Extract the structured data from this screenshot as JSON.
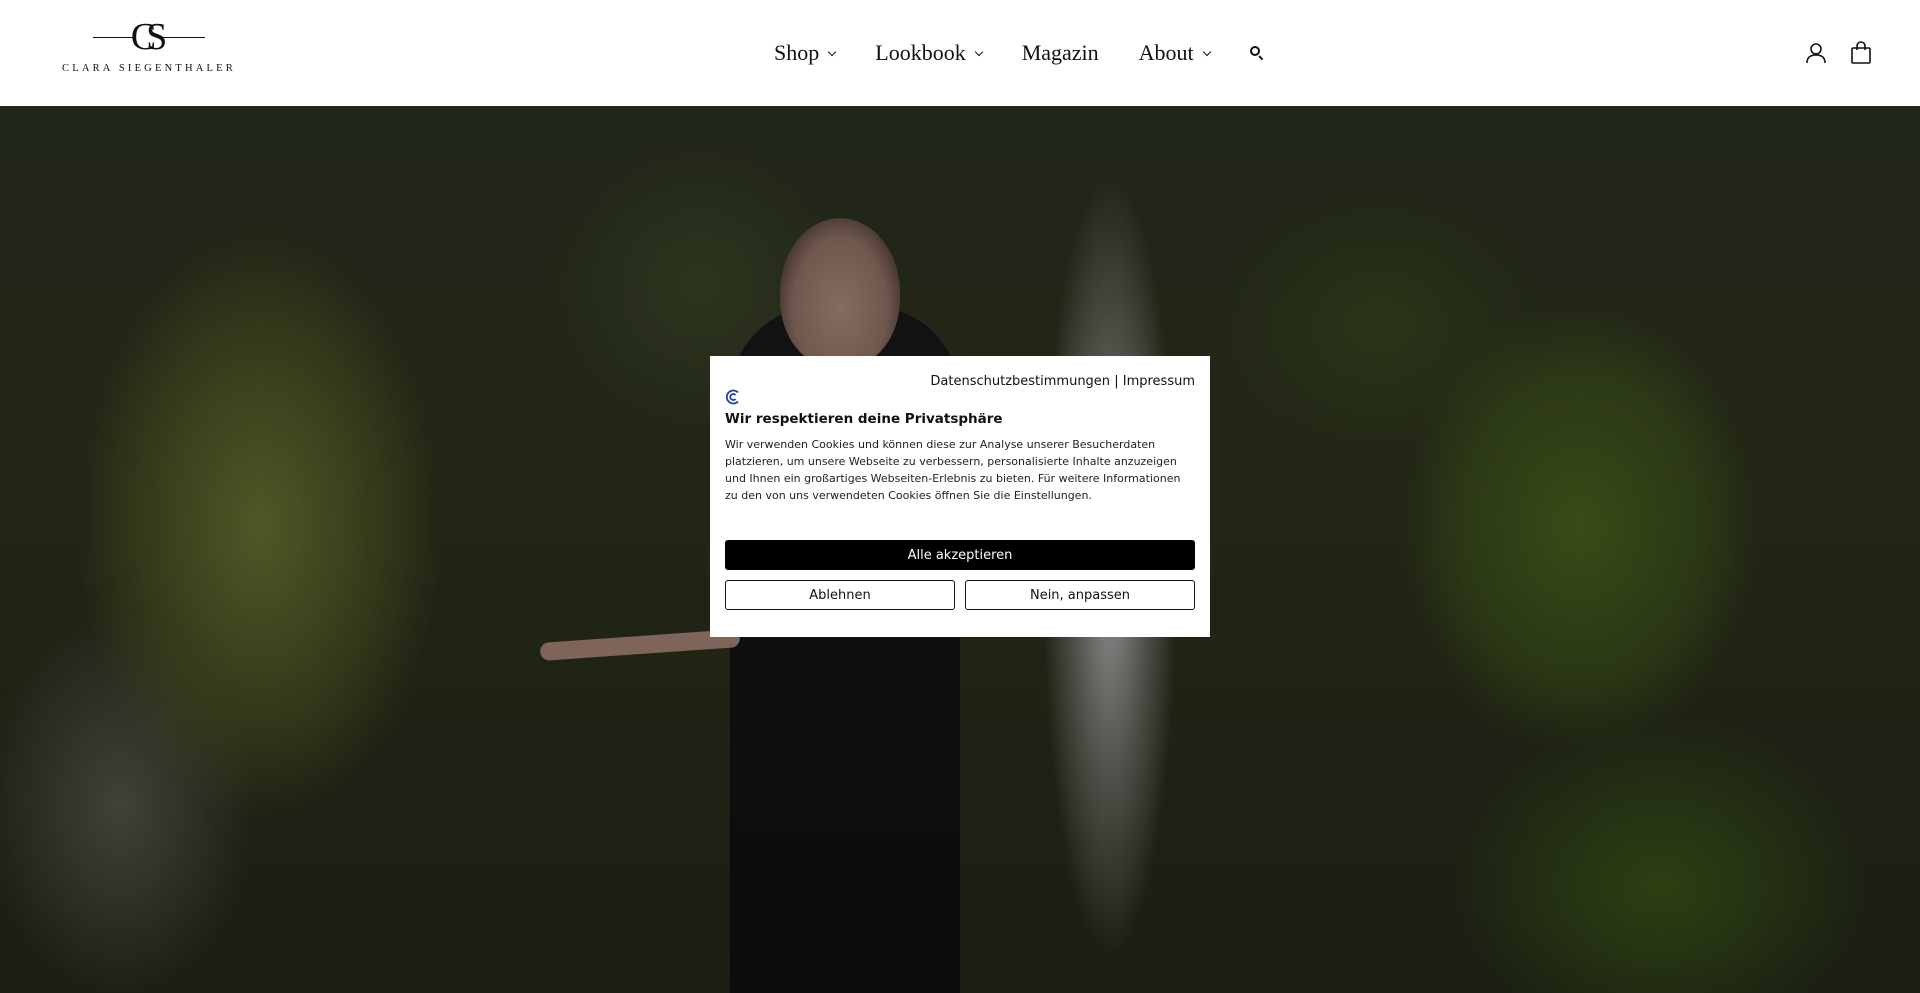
{
  "brand": {
    "monogram": "CS",
    "name": "CLARA SIEGENTHALER"
  },
  "nav": {
    "items": [
      {
        "label": "Shop",
        "dropdown": true
      },
      {
        "label": "Lookbook",
        "dropdown": true
      },
      {
        "label": "Magazin",
        "dropdown": false
      },
      {
        "label": "About",
        "dropdown": true
      }
    ],
    "search_icon": "search-icon"
  },
  "header_icons": {
    "account": "user-icon",
    "cart": "shopping-bag-icon"
  },
  "cookie_banner": {
    "links": {
      "privacy": "Datenschutzbestimmungen",
      "separator": "|",
      "imprint": "Impressum"
    },
    "title": "Wir respektieren deine Privatsphäre",
    "text": "Wir verwenden Cookies und können diese zur Analyse unserer Besucherdaten platzieren, um unsere Webseite zu verbessern, personalisierte Inhalte anzuzeigen und Ihnen ein großartiges Webseiten-Erlebnis zu bieten. Für weitere Informationen zu den von uns verwendeten Cookies öffnen Sie die Einstellungen.",
    "accept_label": "Alle akzeptieren",
    "reject_label": "Ablehnen",
    "customize_label": "Nein, anpassen",
    "logo_icon": "cookie-consent-logo-icon"
  },
  "colors": {
    "accept_button_bg": "#000000",
    "header_bg": "#ffffff",
    "consent_logo_blue": "#1f3fa0"
  }
}
